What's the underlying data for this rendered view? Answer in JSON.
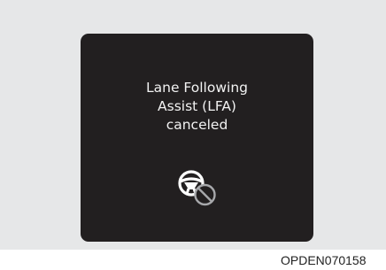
{
  "display": {
    "message_lines": [
      "Lane Following",
      "Assist (LFA)",
      "canceled"
    ],
    "icon": "steering-wheel-cancel-icon"
  },
  "figure_code": "OPDEN070158"
}
